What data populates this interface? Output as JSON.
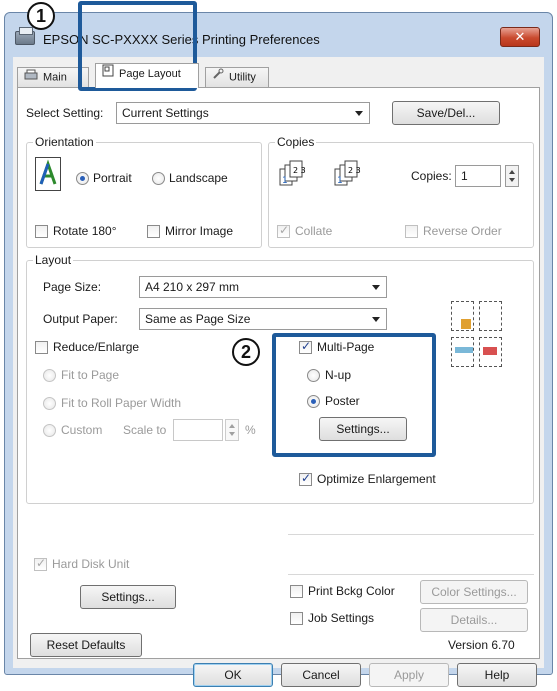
{
  "window": {
    "title": "EPSON SC-PXXXX Series Printing Preferences",
    "close_label": "✕"
  },
  "tabs": [
    {
      "label": "Main"
    },
    {
      "label": "Page Layout"
    },
    {
      "label": "Utility"
    }
  ],
  "callouts": {
    "one": "1",
    "two": "2"
  },
  "select_setting": {
    "label": "Select Setting:",
    "value": "Current Settings",
    "save_label": "Save/Del..."
  },
  "orientation": {
    "group_label": "Orientation",
    "portrait": "Portrait",
    "landscape": "Landscape",
    "rotate180": "Rotate 180°",
    "mirror": "Mirror Image",
    "selected": "Portrait"
  },
  "copies": {
    "group_label": "Copies",
    "copies_label": "Copies:",
    "copies_value": "1",
    "collate": "Collate",
    "reverse_order": "Reverse Order"
  },
  "layout": {
    "group_label": "Layout",
    "page_size_label": "Page Size:",
    "page_size_value": "A4 210 x 297 mm",
    "output_paper_label": "Output Paper:",
    "output_paper_value": "Same as Page Size",
    "reduce_enlarge": "Reduce/Enlarge",
    "fit_to_page": "Fit to Page",
    "fit_to_roll": "Fit to Roll Paper Width",
    "custom": "Custom",
    "scale_to": "Scale to",
    "percent": "%",
    "multi_page": "Multi-Page",
    "n_up": "N-up",
    "poster": "Poster",
    "settings_label": "Settings...",
    "optimize": "Optimize Enlargement"
  },
  "lower": {
    "hard_disk": "Hard Disk Unit",
    "hd_settings": "Settings...",
    "print_bckg": "Print Bckg Color",
    "color_settings": "Color Settings...",
    "job_settings": "Job Settings",
    "details": "Details..."
  },
  "footer": {
    "reset_defaults": "Reset Defaults",
    "version": "Version 6.70",
    "ok": "OK",
    "cancel": "Cancel",
    "apply": "Apply",
    "help": "Help"
  },
  "colors": {
    "accent": "#1e5a9a",
    "title_bg": "#c4d6ec",
    "close": "#c94a2e"
  }
}
